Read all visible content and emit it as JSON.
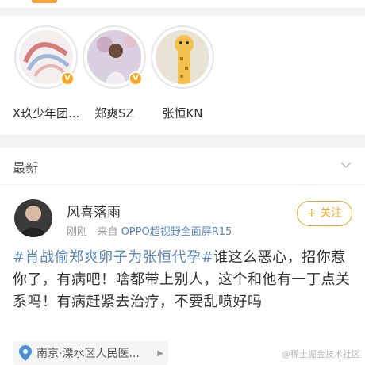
{
  "accounts": [
    {
      "name": "X玖少年团...",
      "verified": true,
      "avatar_icon": "abstract-art-avatar"
    },
    {
      "name": "郑爽SZ",
      "verified": true,
      "avatar_icon": "person-photo-avatar"
    },
    {
      "name": "张恒KN",
      "verified": false,
      "avatar_icon": "giraffe-cartoon-avatar"
    }
  ],
  "section": {
    "title": "最新",
    "toggle_icon": "chevron-down-icon"
  },
  "post": {
    "username": "风喜落雨",
    "time": "刚刚",
    "source_prefix": "来自",
    "source": "OPPO超视野全面屏R15",
    "follow_label": "+ 关注",
    "hashtag": "#肖战偷郑爽卵子为张恒代孕#",
    "text": "谁这么恶心，招你惹你了，有病吧！啥都带上别人，这个和他有一丁点关系吗！有病赶紧去治疗，不要乱喷好吗",
    "location": "南京·溧水区人民医..."
  },
  "watermark": "@稀土掘金技术社区",
  "colors": {
    "accent": "#f5a623",
    "link": "#5b86b8"
  }
}
